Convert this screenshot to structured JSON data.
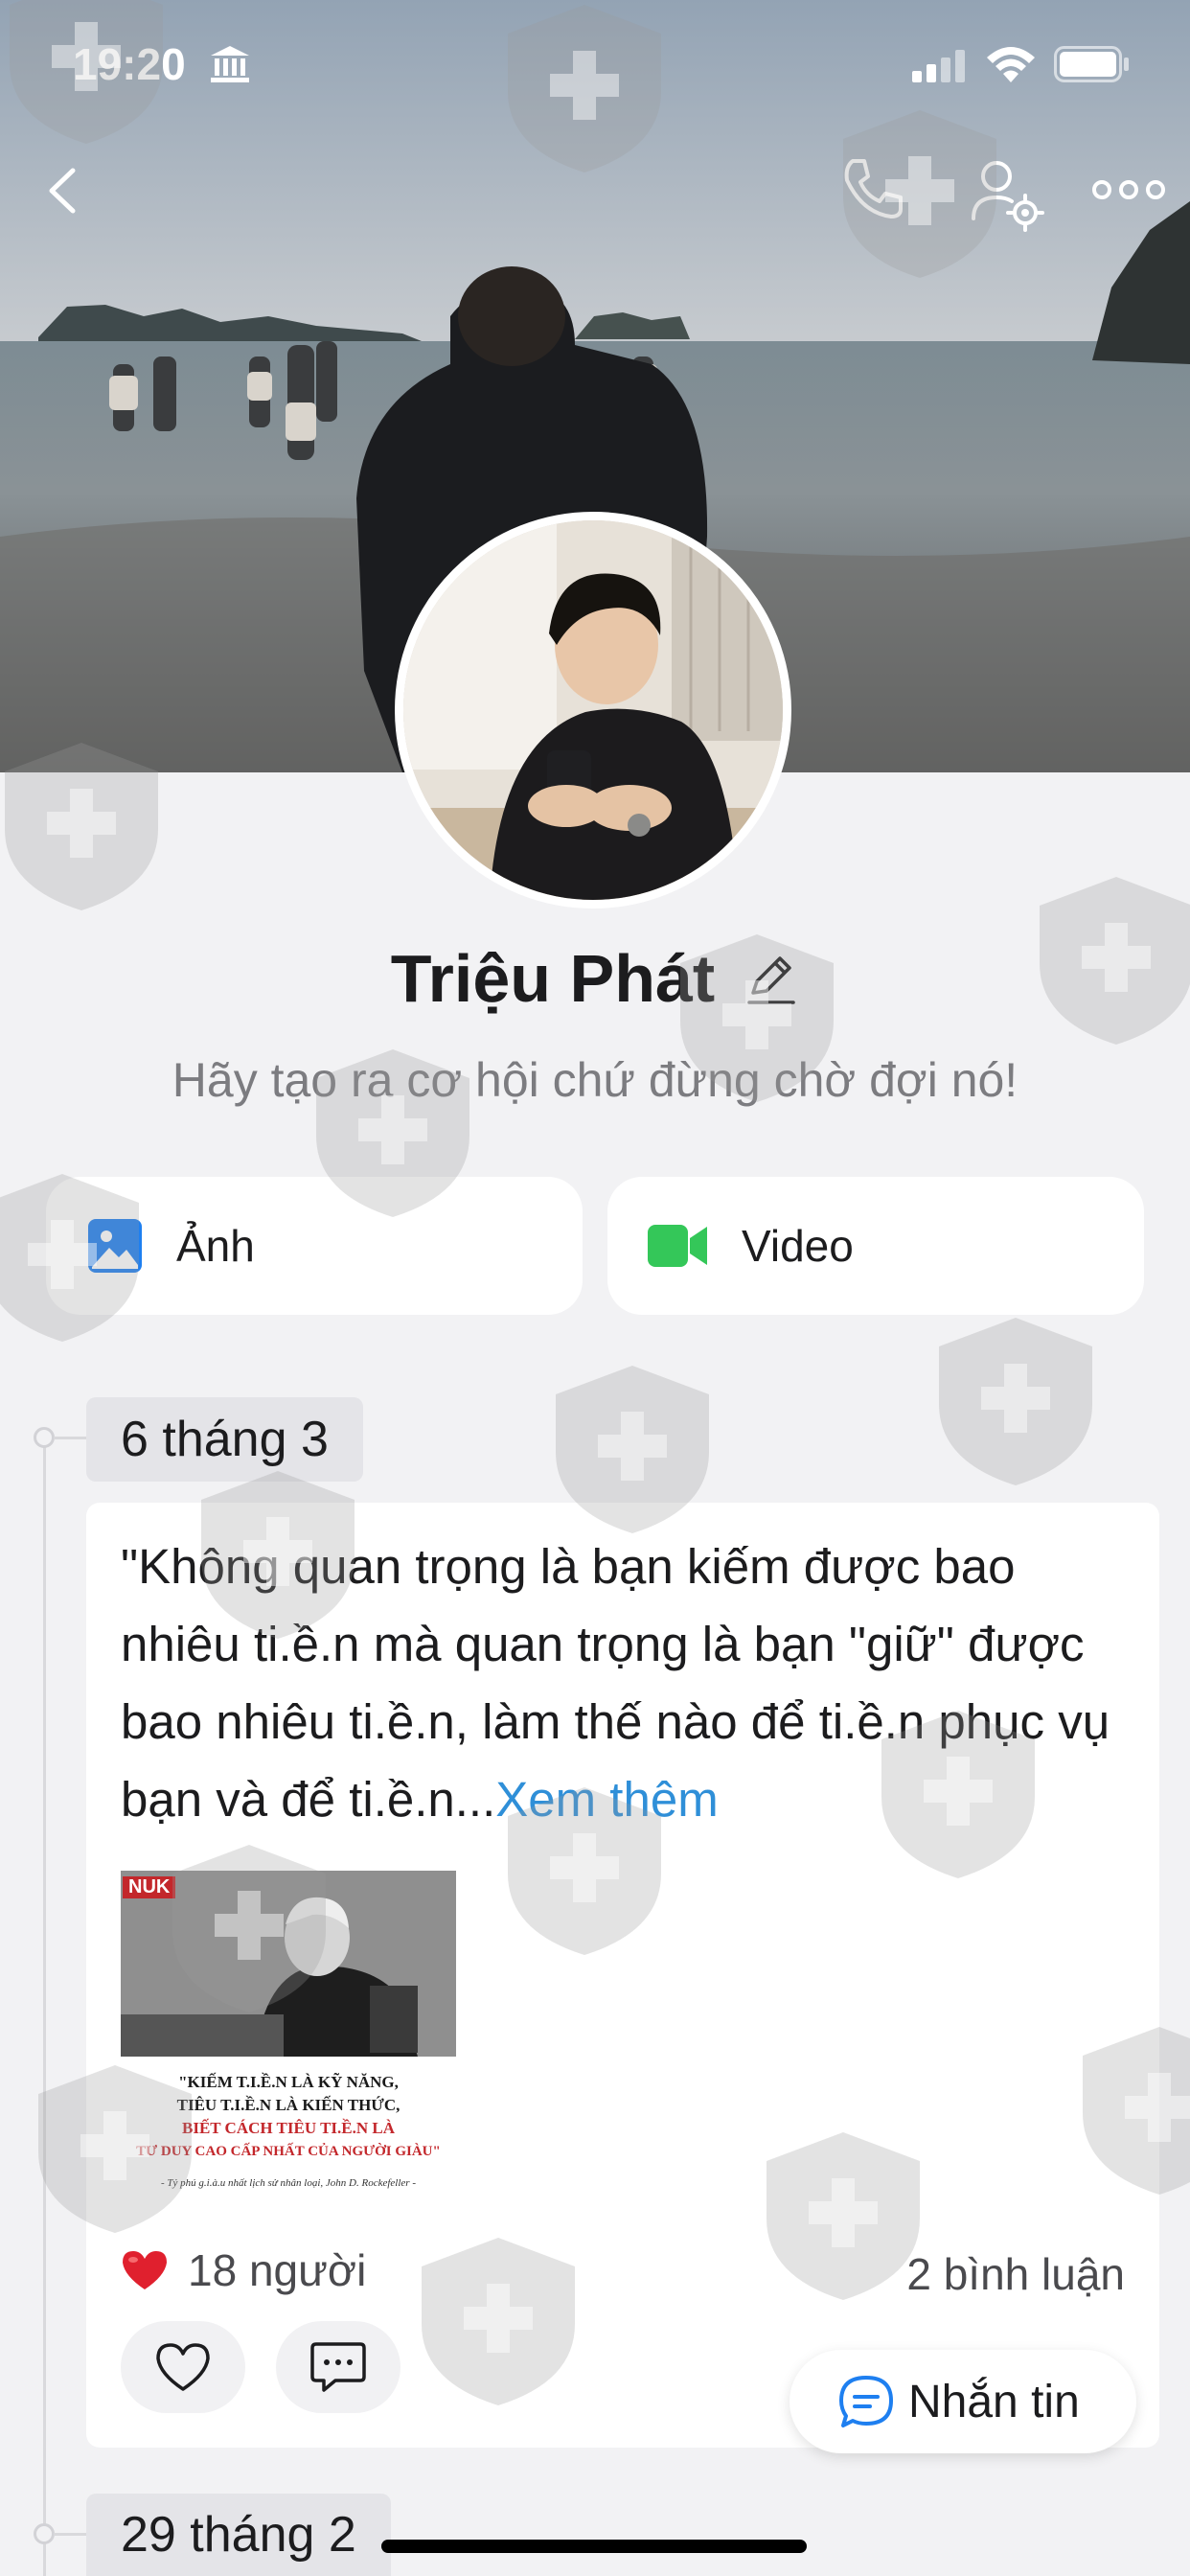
{
  "status_bar": {
    "time": "19:20"
  },
  "nav": {
    "back_icon": "chevron-left-icon",
    "call_icon": "phone-icon",
    "settings_icon": "user-settings-icon",
    "more_icon": "more-horizontal-icon"
  },
  "profile": {
    "name": "Triệu Phát",
    "bio": "Hãy tạo ra cơ hội chứ đừng chờ đợi nó!"
  },
  "media_buttons": {
    "photo_label": "Ảnh",
    "video_label": "Video"
  },
  "timeline": [
    {
      "date": "6 tháng 3",
      "post": {
        "text": "\"Không quan trọng là bạn kiếm được bao nhiêu ti.ề.n mà quan trọng là bạn \"giữ\" được bao nhiêu ti.ề.n, làm thế nào để ti.ề.n phục vụ bạn và để ti.ề.n...",
        "see_more": "Xem thêm",
        "image": {
          "logo": "NUK",
          "quote_lines": [
            "\"KIẾM T.I.Ề.N LÀ KỸ NĂNG,",
            "TIÊU T.I.Ề.N LÀ KIẾN THỨC,",
            "BIẾT CÁCH TIÊU TI.Ề.N LÀ",
            "TƯ DUY CAO CẤP NHẤT CỦA NGƯỜI GIÀU\""
          ],
          "credit": "- Tỷ phú g.i.à.u nhất lịch sử nhân loại, John D. Rockefeller -"
        },
        "likes": "18 người",
        "comments": "2 bình luận"
      }
    },
    {
      "date": "29 tháng 2"
    }
  ],
  "message_button": {
    "label": "Nhắn tin"
  },
  "colors": {
    "background": "#f2f2f4",
    "accent_blue": "#2f8fd8",
    "video_green": "#34c759",
    "heart_red": "#e0202e"
  }
}
